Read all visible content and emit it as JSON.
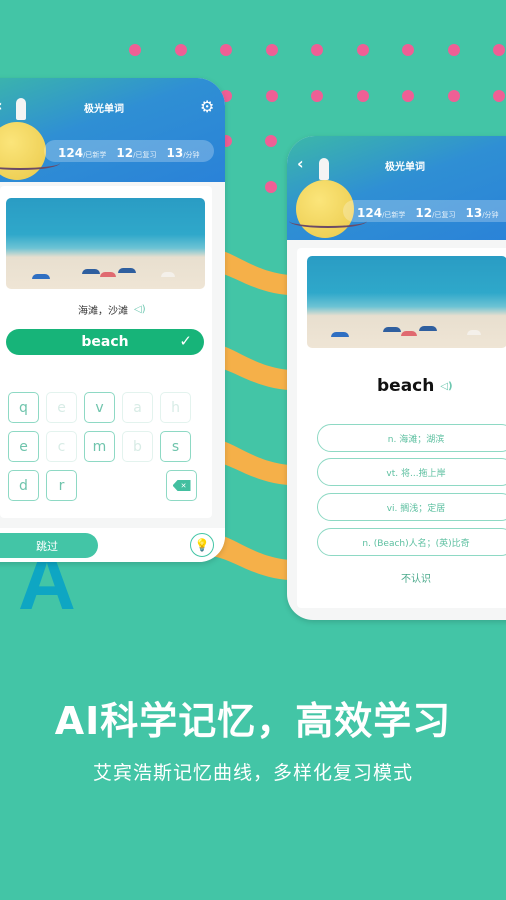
{
  "colors": {
    "background": "#43c5a6",
    "dots": "#ef5f95",
    "waves": "#f5b049",
    "accent_green": "#17b479",
    "key_border": "#8ed9c4",
    "header_blue": "#2a82d8"
  },
  "left_phone": {
    "back_icon": "chevron-left-icon",
    "title": "极光单词",
    "settings_icon": "gear-icon",
    "stats": [
      {
        "value": "124",
        "label": "/已新学"
      },
      {
        "value": "12",
        "label": "/已复习"
      },
      {
        "value": "13",
        "label": "/分钟"
      }
    ],
    "meaning": "海滩，沙滩",
    "answer": "beach",
    "answer_status_icon": "check-icon",
    "keyboard": {
      "rows": [
        [
          {
            "key": "q",
            "used": false
          },
          {
            "key": "e",
            "used": true
          },
          {
            "key": "v",
            "used": false
          },
          {
            "key": "a",
            "used": true
          },
          {
            "key": "h",
            "used": true
          }
        ],
        [
          {
            "key": "e",
            "used": false
          },
          {
            "key": "c",
            "used": true
          },
          {
            "key": "m",
            "used": false
          },
          {
            "key": "b",
            "used": true
          },
          {
            "key": "s",
            "used": false
          }
        ],
        [
          {
            "key": "d",
            "used": false
          },
          {
            "key": "r",
            "used": false
          }
        ]
      ],
      "delete_icon": "backspace-icon"
    },
    "skip_label": "跳过",
    "hint_icon": "lightbulb-icon"
  },
  "right_phone": {
    "back_icon": "chevron-left-icon",
    "title": "极光单词",
    "stats": [
      {
        "value": "124",
        "label": "/已新学"
      },
      {
        "value": "12",
        "label": "/已复习"
      },
      {
        "value": "13",
        "label": "/分钟"
      }
    ],
    "word": "beach",
    "options": [
      "n. 海滩；湖滨",
      "vt. 将...拖上岸",
      "vi. 搁浅；定居",
      "n. (Beach)人名；(英)比奇"
    ],
    "unknown_label": "不认识"
  },
  "decor_letter": "A",
  "headline": "AI科学记忆，高效学习",
  "subheadline": "艾宾浩斯记忆曲线，多样化复习模式"
}
